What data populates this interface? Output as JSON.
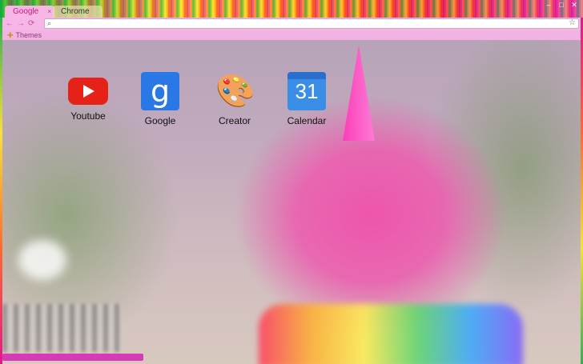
{
  "browser": {
    "tabs": [
      {
        "label": "Google",
        "active": true
      },
      {
        "label": "Chrome",
        "active": false
      }
    ],
    "window_controls": [
      "–",
      "□",
      "✕"
    ],
    "nav": {
      "back": "←",
      "forward": "→",
      "reload": "⟳"
    },
    "omnibox": {
      "value": "",
      "search_icon": "magnifier-icon",
      "star_icon": "☆"
    },
    "bookmarks": [
      {
        "label": "Themes",
        "icon": "puzzle-icon"
      }
    ]
  },
  "apps": [
    {
      "label": "Youtube"
    },
    {
      "label": "Google",
      "glyph": "g"
    },
    {
      "label": "Creator",
      "glyph": "🎨"
    },
    {
      "label": "Calendar",
      "glyph": "31"
    }
  ],
  "colors": {
    "accent_pink": "#f7b7e6",
    "tab_text_active": "#d0187a",
    "progress_bar": "#d63bb5"
  }
}
